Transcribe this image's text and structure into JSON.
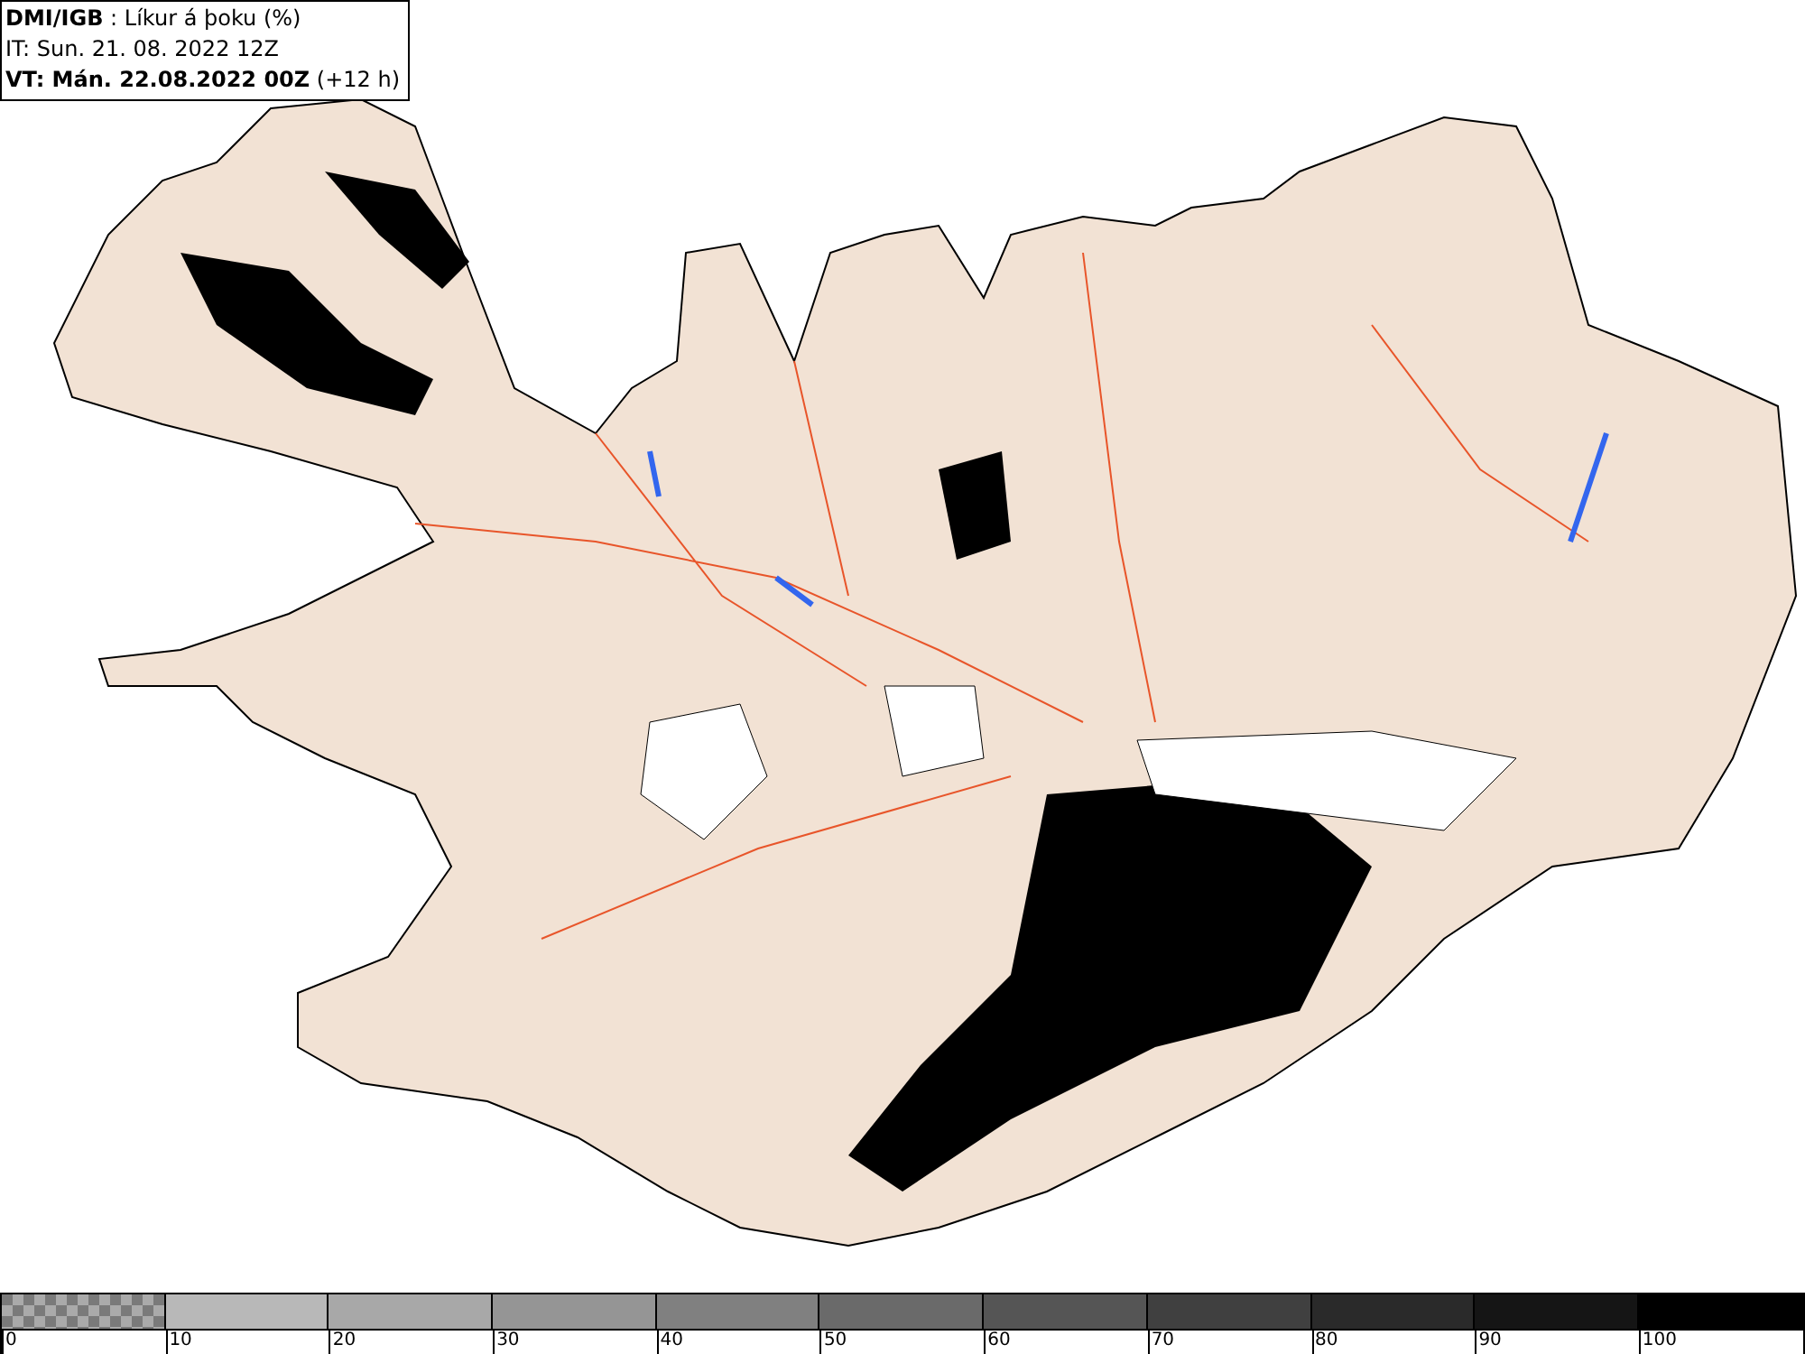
{
  "header": {
    "lines": [
      "**DMI/IGB** : Líkur á þoku (%)",
      "IT: Sun. 21. 08. 2022 12Z",
      "**VT: Mán. 22.08.2022 00Z** (+12 h)"
    ]
  },
  "legend": {
    "bins": [
      {
        "kind": "checker",
        "color": "#7a7a7a"
      },
      {
        "kind": "solid",
        "color": "#b8b8b8"
      },
      {
        "kind": "solid",
        "color": "#a8a8a8"
      },
      {
        "kind": "solid",
        "color": "#959595"
      },
      {
        "kind": "solid",
        "color": "#808080"
      },
      {
        "kind": "solid",
        "color": "#6a6a6a"
      },
      {
        "kind": "solid",
        "color": "#555555"
      },
      {
        "kind": "solid",
        "color": "#404040"
      },
      {
        "kind": "solid",
        "color": "#2a2a2a"
      },
      {
        "kind": "solid",
        "color": "#151515"
      },
      {
        "kind": "solid",
        "color": "#000000"
      }
    ],
    "ticks": [
      "0",
      "10",
      "20",
      "30",
      "40",
      "50",
      "60",
      "70",
      "80",
      "90",
      "100"
    ]
  }
}
